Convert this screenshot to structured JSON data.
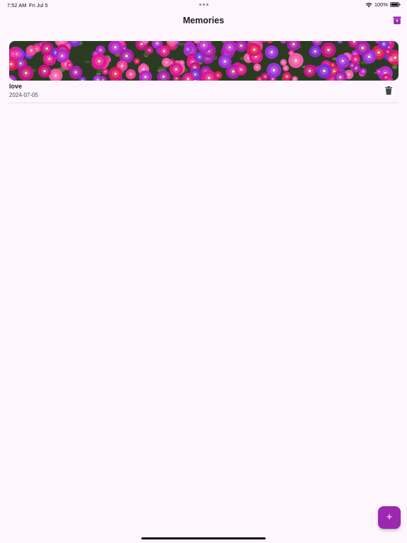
{
  "status_bar": {
    "time": "7:52 AM",
    "date": "Fri Jul 5",
    "battery": "100%"
  },
  "app_bar": {
    "title": "Memories",
    "action_icon": "archive-icon"
  },
  "memories": [
    {
      "title": "love",
      "date": "2024-07-05",
      "image": "pink-purple-flowers-photo",
      "delete_icon": "trash-icon"
    }
  ],
  "fab": {
    "label": "+",
    "icon": "plus-icon"
  },
  "colors": {
    "accent": "#9c27b0",
    "background": "#fdf7fd"
  }
}
